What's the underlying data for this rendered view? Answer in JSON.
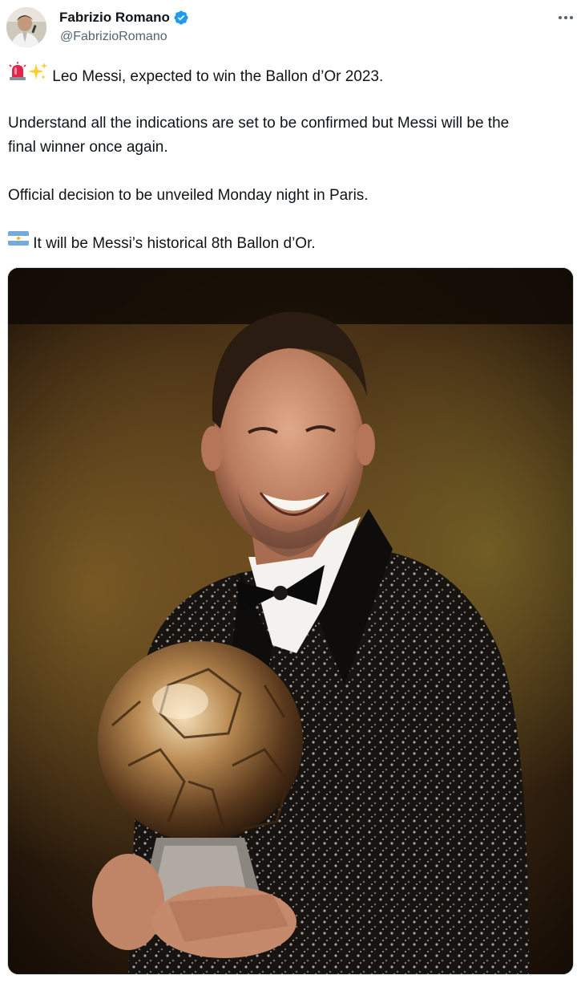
{
  "author": {
    "display_name": "Fabrizio Romano",
    "handle": "@FabrizioRomano",
    "verified": true,
    "avatar_icon": "profile-photo"
  },
  "tweet": {
    "line1": "Leo Messi, expected to win the Ballon d’Or 2023.",
    "line2": "Understand all the indications are set to be confirmed but Messi will be the",
    "line3": "final winner once again.",
    "line4": "Official decision to be unveiled Monday night in Paris.",
    "line5": "It will be Messi’s historical 8th Ballon d’Or.",
    "emojis": [
      "siren-emoji",
      "sparkles-emoji",
      "argentina-flag-emoji"
    ]
  },
  "media": {
    "description_icon": "messi-with-ballon-dor-photo"
  },
  "colors": {
    "verified_blue": "#1d9bf0",
    "handle_gray": "#536471",
    "text": "#0f1419"
  }
}
